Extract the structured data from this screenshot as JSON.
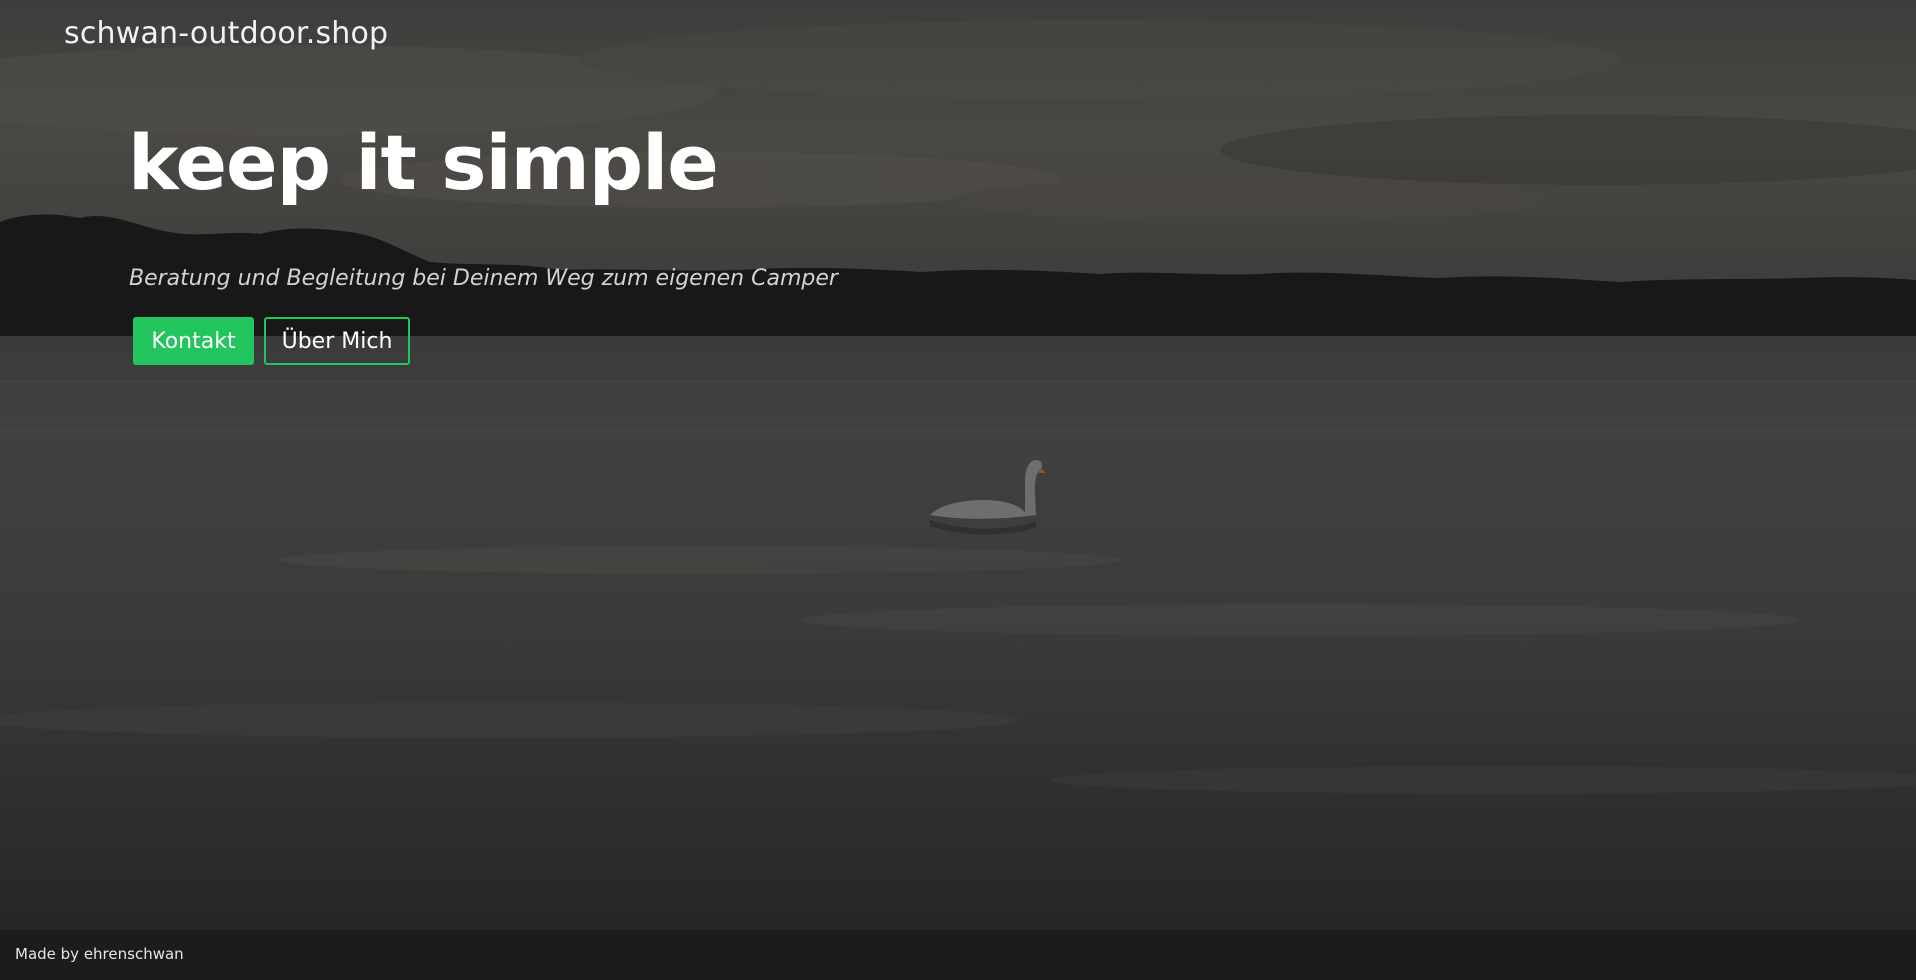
{
  "header": {
    "site_title": "schwan-outdoor.shop"
  },
  "hero": {
    "headline": "keep it simple",
    "subline": "Beratung und Begleitung bei Deinem Weg zum eigenen Camper",
    "buttons": [
      {
        "label": "Kontakt"
      },
      {
        "label": "Über Mich"
      }
    ]
  },
  "footer": {
    "text": "Made by ehrenschwan"
  },
  "colors": {
    "accent": "#22c55e",
    "footer_bg": "#1c1c1c"
  }
}
